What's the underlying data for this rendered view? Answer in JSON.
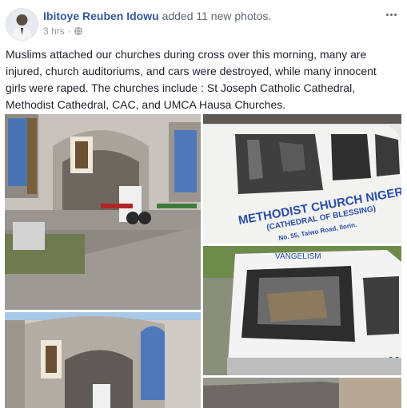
{
  "post": {
    "author": "Ibitoye Reuben Idowu",
    "action": "added 11 new photos.",
    "time": "3 hrs",
    "separator": "·",
    "body": "Muslims attached our churches during cross over this morning, many are injured, church auditoriums, and cars were destroyed, while many innocent girls were raped. The churches include : St Joseph Catholic Cathedral, Methodist Cathedral, CAC, and UMCA Hausa Churches."
  },
  "icons": {
    "avatar": "avatar-photo",
    "privacy": "globe-icon",
    "menu": "more-options-icon"
  },
  "photos": {
    "van_text_1": "METHODIST CHURCH NIGERIA",
    "van_text_2": "(CATHEDRAL OF BLESSING)",
    "van_text_3": "No. 55, Taiwo Road, Ilorin.",
    "van_text_4": "VANGELISM",
    "van_text_5": "M"
  },
  "colors": {
    "author": "#365899",
    "meta": "#90949c",
    "text": "#1d2129"
  }
}
